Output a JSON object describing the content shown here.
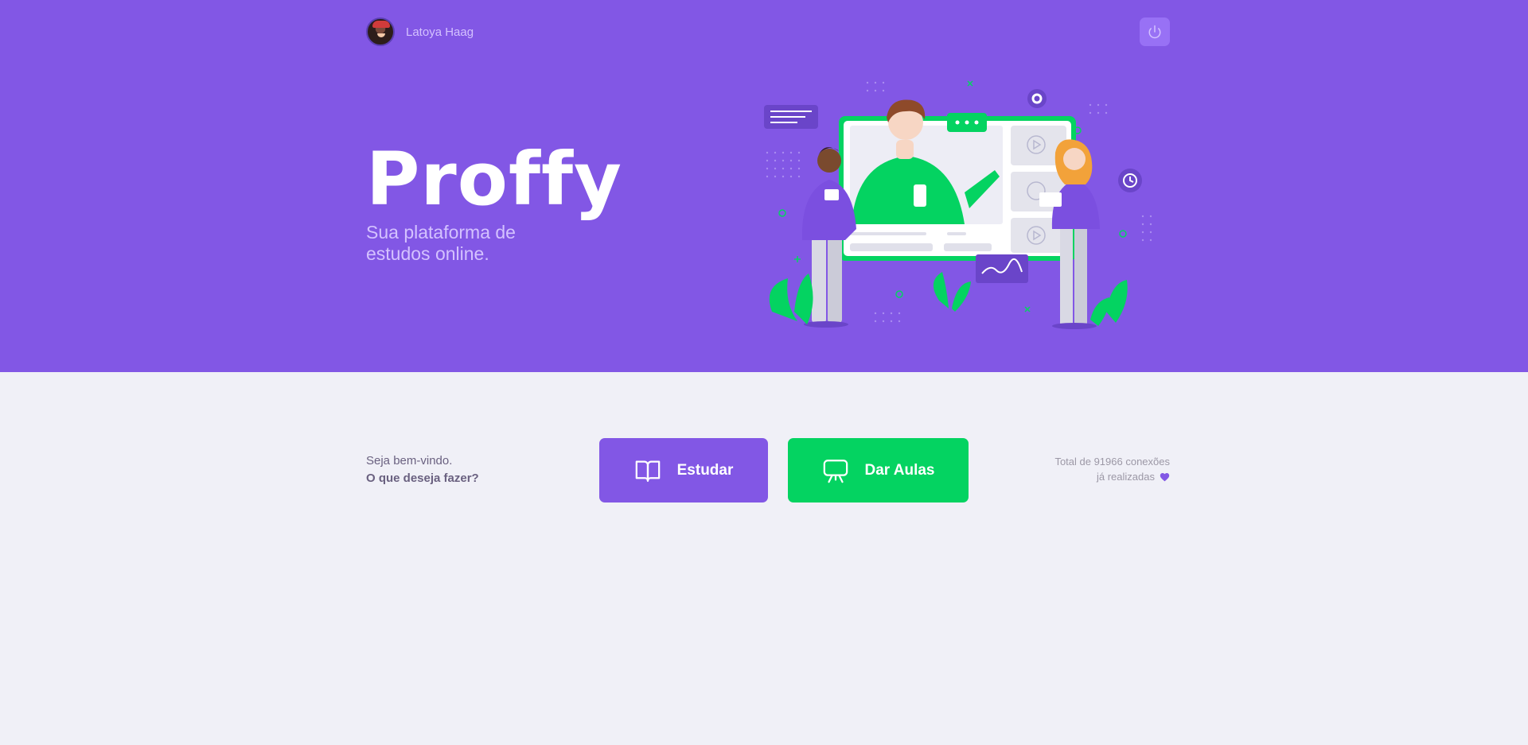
{
  "user": {
    "name": "Latoya Haag"
  },
  "header": {
    "logout_icon": "power-icon"
  },
  "hero": {
    "logo": "Proffy",
    "tagline": "Sua plataforma de estudos online."
  },
  "welcome": {
    "line1": "Seja bem-vindo.",
    "line2": "O que deseja fazer?"
  },
  "actions": {
    "study": {
      "label": "Estudar",
      "icon": "book-icon"
    },
    "give_classes": {
      "label": "Dar Aulas",
      "icon": "presentation-board-icon"
    }
  },
  "connections": {
    "line1": "Total de 91966 conexões",
    "line2": "já realizadas",
    "icon": "heart-icon"
  },
  "colors": {
    "primary": "#8257E5",
    "secondary": "#04D361",
    "background": "#F0F0F7",
    "text_in_primary": "#D4C2FF"
  }
}
